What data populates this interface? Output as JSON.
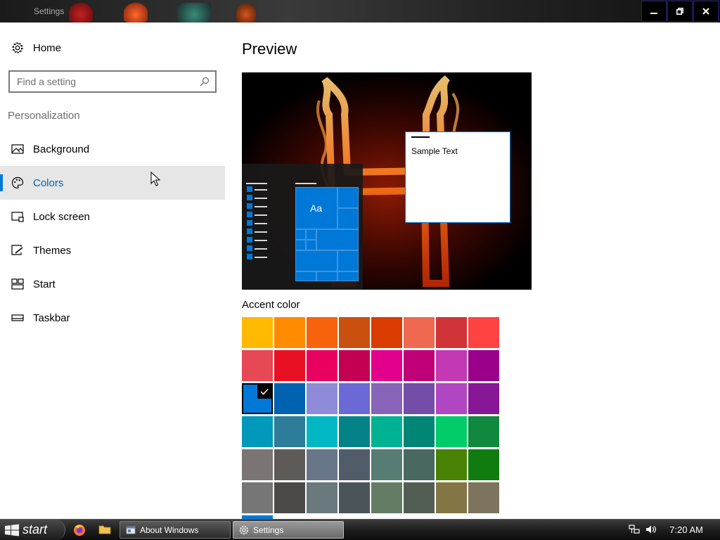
{
  "window": {
    "title": "Settings",
    "controls": {
      "minimize": "minimize-icon",
      "restore": "restore-icon",
      "close": "close-icon"
    }
  },
  "sidebar": {
    "home_label": "Home",
    "search": {
      "placeholder": "Find a setting",
      "value": ""
    },
    "section_title": "Personalization",
    "items": [
      {
        "label": "Background",
        "icon": "picture-icon"
      },
      {
        "label": "Colors",
        "icon": "palette-icon",
        "selected": true
      },
      {
        "label": "Lock screen",
        "icon": "lock-screen-icon"
      },
      {
        "label": "Themes",
        "icon": "brush-icon"
      },
      {
        "label": "Start",
        "icon": "start-tiles-icon"
      },
      {
        "label": "Taskbar",
        "icon": "taskbar-icon"
      }
    ]
  },
  "main": {
    "title": "Preview",
    "preview": {
      "tile_label": "Aa",
      "sample_text": "Sample Text"
    },
    "accent_label": "Accent color",
    "accent_colors": [
      [
        "#ffb900",
        "#ff8c00",
        "#f7630c",
        "#ca5010",
        "#da3b01",
        "#ef6950",
        "#d13438",
        "#ff4343"
      ],
      [
        "#e74856",
        "#e81123",
        "#ea005e",
        "#c30052",
        "#e3008c",
        "#bf0077",
        "#c239b3",
        "#9a0089"
      ],
      [
        "#0078d7",
        "#0063b1",
        "#8e8cd8",
        "#6b69d6",
        "#8764b8",
        "#744da9",
        "#b146c2",
        "#881798"
      ],
      [
        "#0099bc",
        "#2d7d9a",
        "#00b7c3",
        "#038387",
        "#00b294",
        "#018574",
        "#00cc6a",
        "#10893e"
      ],
      [
        "#7a7574",
        "#5d5a58",
        "#68768a",
        "#515c6b",
        "#567c73",
        "#486860",
        "#498205",
        "#107c10"
      ],
      [
        "#767676",
        "#4c4a48",
        "#69797e",
        "#4a5459",
        "#647c64",
        "#525e54",
        "#847545",
        "#7e735f"
      ]
    ],
    "selected_accent": "#0078d7"
  },
  "taskbar": {
    "start_label": "start",
    "tasks": [
      {
        "label": "About Windows",
        "icon": "window-icon"
      },
      {
        "label": "Settings",
        "icon": "gear-icon",
        "active": true
      }
    ],
    "quick_launch": [
      "firefox-icon",
      "folder-icon"
    ],
    "clock": "7:20 AM",
    "tray_icons": [
      "network-icon",
      "volume-icon"
    ]
  }
}
